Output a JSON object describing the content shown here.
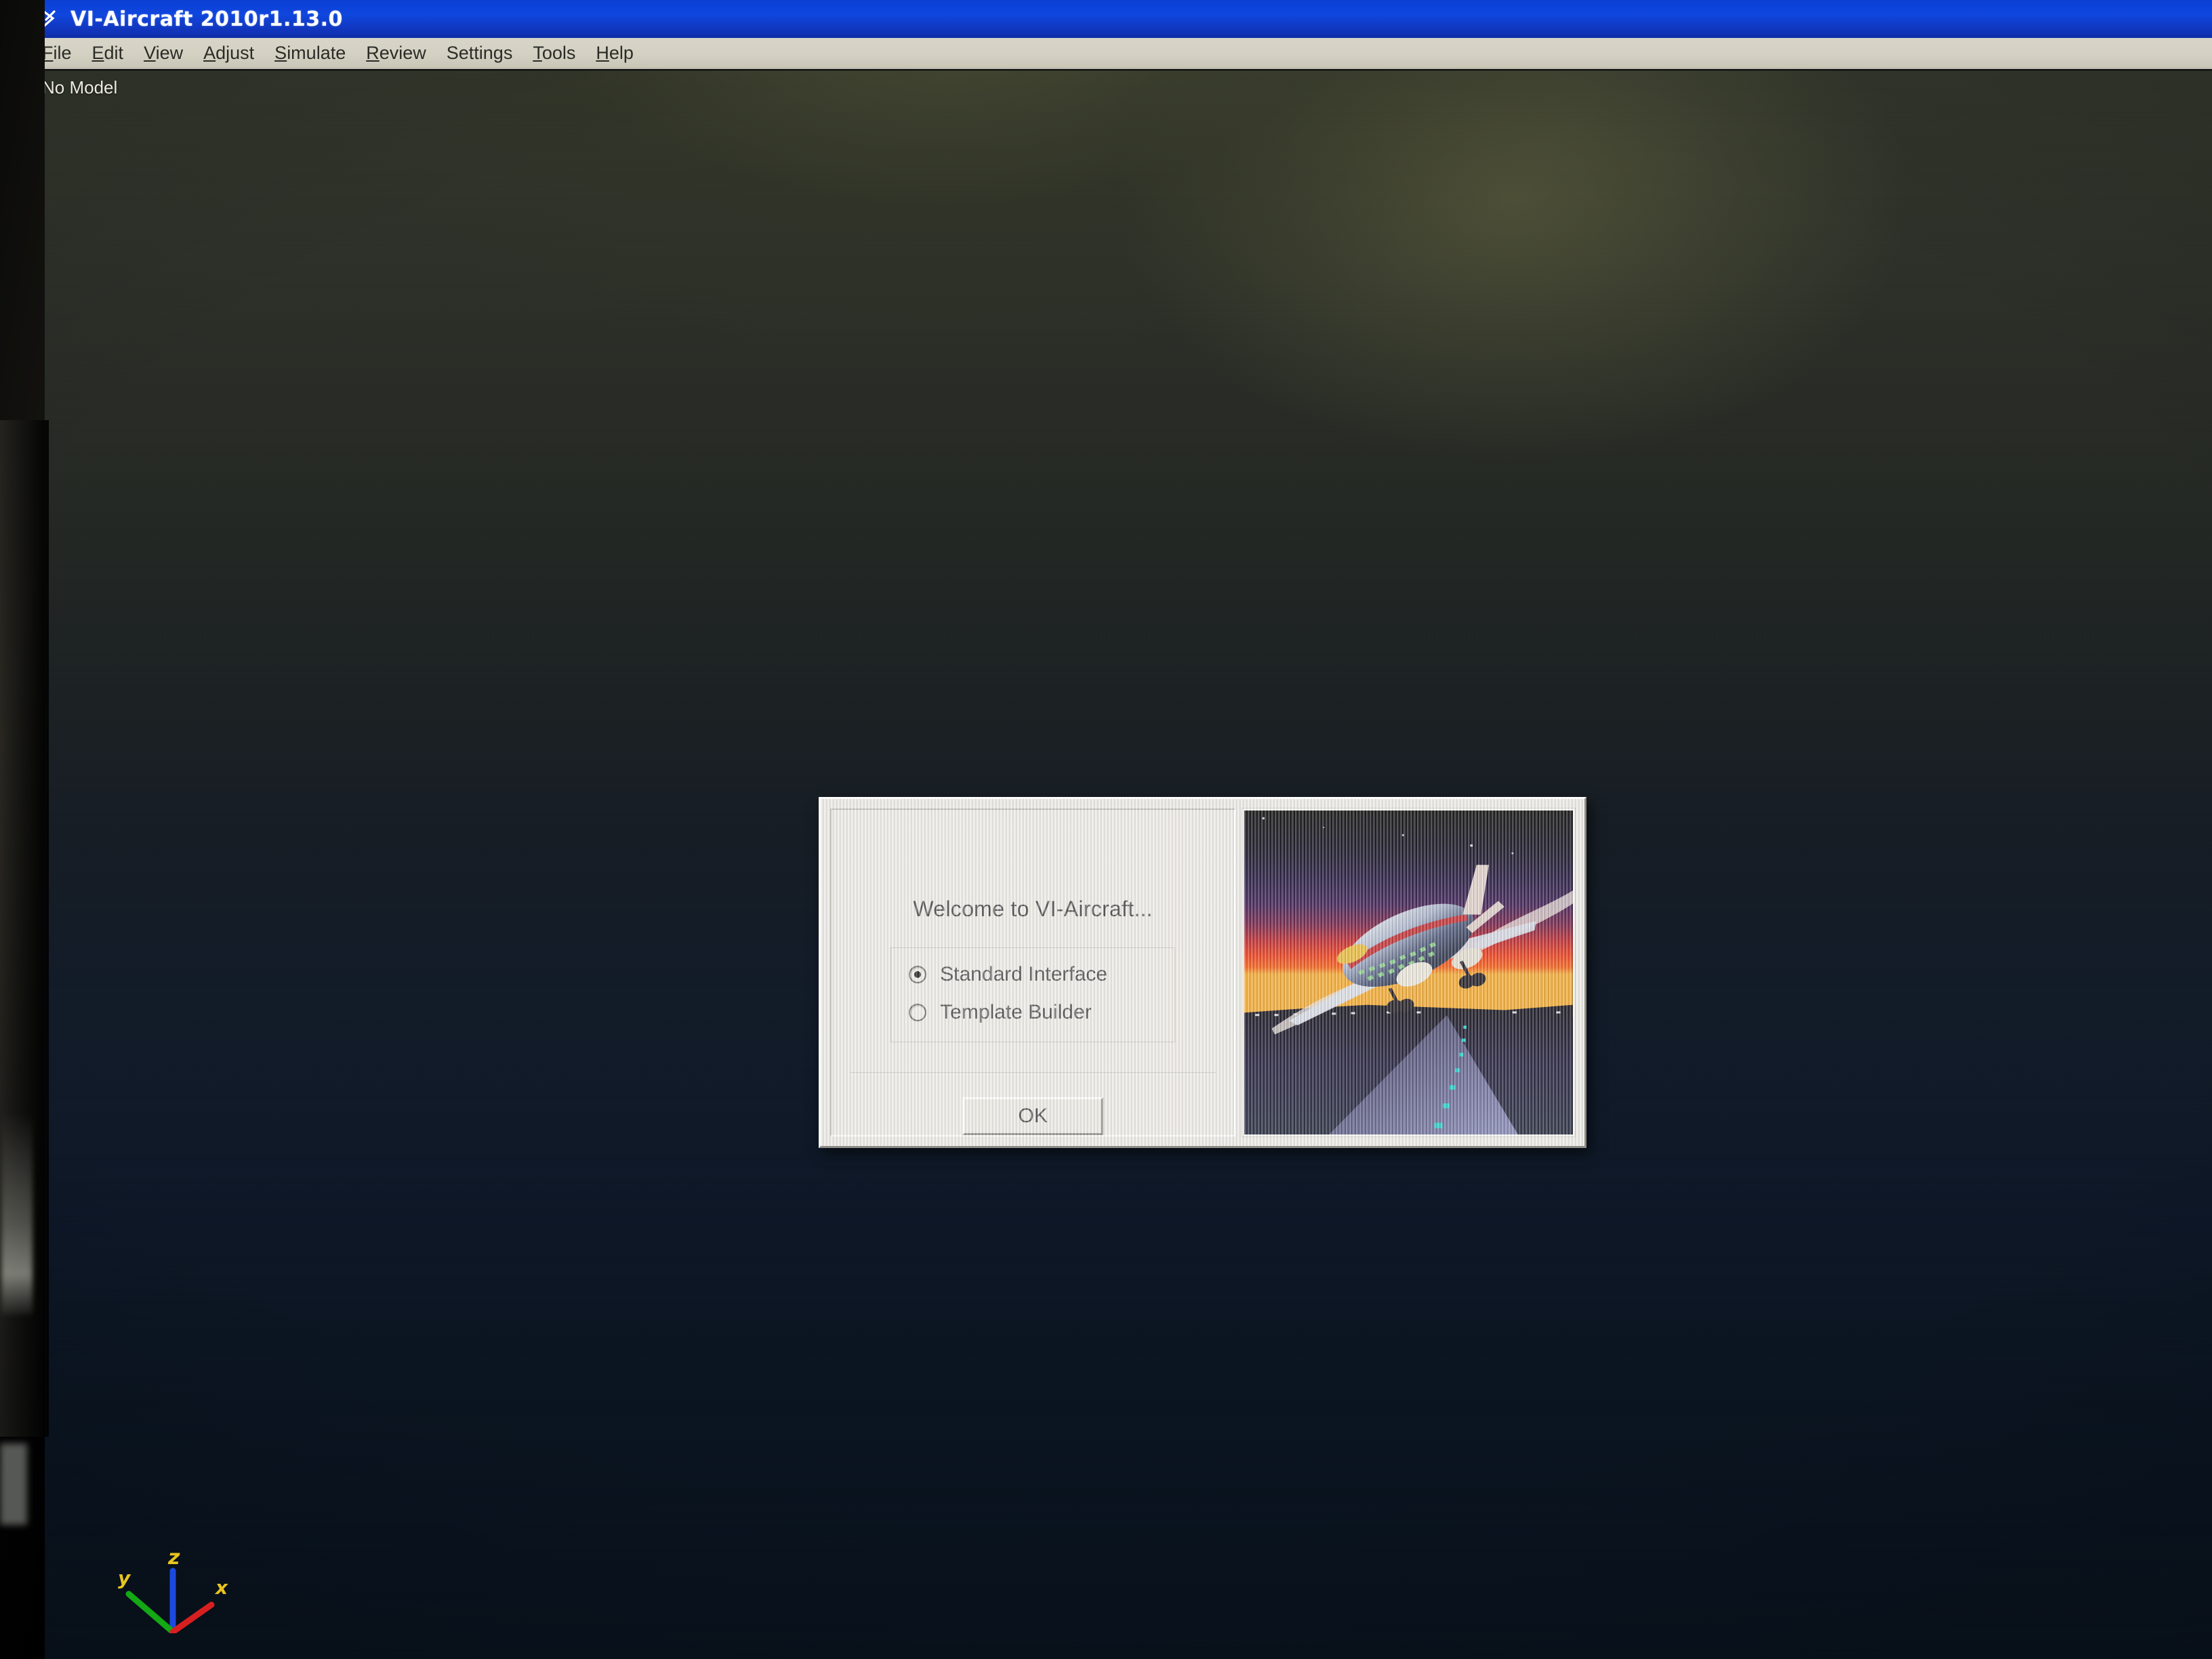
{
  "window": {
    "title": "VI-Aircraft 2010r1.13.0",
    "icon": "aircraft-arrow-icon",
    "titlebar_color": "#0f46de"
  },
  "menubar": {
    "items": [
      {
        "label": "File",
        "mnemonic": "F"
      },
      {
        "label": "Edit",
        "mnemonic": "E"
      },
      {
        "label": "View",
        "mnemonic": "V"
      },
      {
        "label": "Adjust",
        "mnemonic": "A"
      },
      {
        "label": "Simulate",
        "mnemonic": "S"
      },
      {
        "label": "Review",
        "mnemonic": "R"
      },
      {
        "label": "Settings",
        "mnemonic": ""
      },
      {
        "label": "Tools",
        "mnemonic": "T"
      },
      {
        "label": "Help",
        "mnemonic": "H"
      }
    ]
  },
  "viewport": {
    "status_text": "No Model",
    "background_top_color": "#31352a",
    "background_bottom_color": "#07101b",
    "axis_triad": {
      "x_label": "x",
      "y_label": "y",
      "z_label": "z",
      "x_color": "#d81f1f",
      "y_color": "#14a814",
      "z_color": "#1c49e0",
      "label_color": "#e8c41e"
    }
  },
  "dialog": {
    "heading": "Welcome to VI-Aircraft...",
    "options": [
      {
        "label": "Standard Interface",
        "selected": true
      },
      {
        "label": "Template Builder",
        "selected": false
      }
    ],
    "ok_label": "OK",
    "background_color": "#eceae5",
    "splash": {
      "alt": "Airliner taking off from a runway at sunset",
      "sky_top_color": "#000000",
      "sky_mid_color": "#2a1045",
      "horizon_color": "#ff3b15",
      "horizon_glow_color": "#ffb43a",
      "ground_color": "#0a0814",
      "runway_light_color": "#18d8d0"
    }
  }
}
